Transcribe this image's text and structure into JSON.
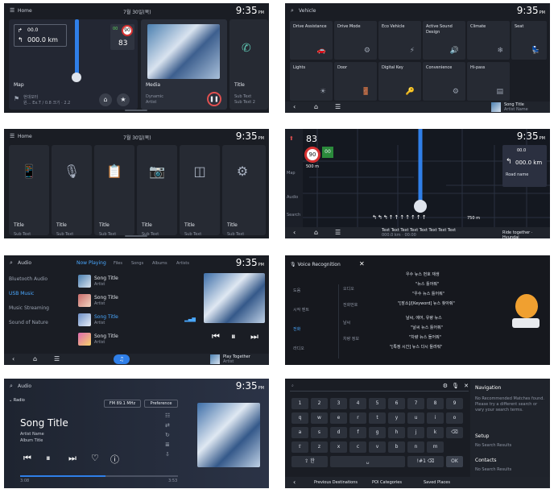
{
  "status": {
    "time": "9:35",
    "ampm": "PM",
    "date": "7월 30일(목)"
  },
  "p1": {
    "title": "Home",
    "dist1": "00.0",
    "dist2": "000.0 km",
    "speed_limit": "90",
    "speed_small": "00",
    "speed": "83",
    "map_label": "Map",
    "map_sub1": "현대모터",
    "map_sub2": "원… Ex.T / 0.8 크기 · 2.2",
    "media_label": "Media",
    "media_sub1": "Dynamic",
    "media_sub2": "Artist",
    "title_label": "Title",
    "sub1": "Sub Text",
    "sub2": "Sub Text 2"
  },
  "p2": {
    "search_text": "Vehicle",
    "tiles": [
      {
        "label": "Drive Assistance",
        "icon": "🚗"
      },
      {
        "label": "Drive Mode",
        "icon": "⚙"
      },
      {
        "label": "Eco Vehicle",
        "icon": "⚡"
      },
      {
        "label": "Active Sound Design",
        "icon": "🔊"
      },
      {
        "label": "Climate",
        "icon": "❄"
      },
      {
        "label": "Seat",
        "icon": "💺"
      },
      {
        "label": "Lights",
        "icon": "☀"
      },
      {
        "label": "Door",
        "icon": "🚪"
      },
      {
        "label": "Digital Key",
        "icon": "🔑"
      },
      {
        "label": "Convenience",
        "icon": "⚙"
      },
      {
        "label": "Hi-pass",
        "icon": "▤"
      }
    ],
    "song": "Song Title",
    "artist": "Artist Name"
  },
  "p3": {
    "title": "Home",
    "tiles": [
      {
        "icon": "📱",
        "title": "Title",
        "s1": "Sub Text",
        "s2": "Sub Text 2"
      },
      {
        "icon": "🎙",
        "title": "Title",
        "s1": "Sub Text",
        "s2": "Sub Text 2"
      },
      {
        "icon": "📋",
        "title": "Title",
        "s1": "Sub Text",
        "s2": "Sub Text 2"
      },
      {
        "icon": "📷",
        "title": "Title",
        "s1": "Sub Text",
        "s2": "Sub Text 2"
      },
      {
        "icon": "◫",
        "title": "Title",
        "s1": "Sub Text",
        "s2": "Sub Text 2"
      },
      {
        "icon": "⚙",
        "title": "Title",
        "s1": "Sub Text",
        "s2": "Sub Text 2"
      }
    ]
  },
  "p4": {
    "speed": "83",
    "limit": "90",
    "green": "00",
    "dist": "500 m",
    "side1": "Map",
    "side2": "Audio",
    "side3": "Search",
    "top_dist": "00.0",
    "main_dist": "000.0 km",
    "road": "Road name",
    "lane_dist": "750 m",
    "bottom_text": "Text Text Text Text Text Text Text Text",
    "bottom_sub": "000.0 km · 00:00",
    "bottom_right": "Ride together · Hyundai"
  },
  "p5": {
    "title": "Audio",
    "tabs": [
      "Now Playing",
      "Files",
      "Songs",
      "Albums",
      "Artists"
    ],
    "sources": [
      "Bluetooth Audio",
      "USB Music",
      "Music Streaming",
      "Sound of Nature"
    ],
    "songs": [
      {
        "title": "Song Title",
        "artist": "Artist"
      },
      {
        "title": "Song Title",
        "artist": "Artist"
      },
      {
        "title": "Song Title",
        "artist": "Artist"
      },
      {
        "title": "Song Title",
        "artist": "Artist"
      }
    ],
    "np_title": "Play Together",
    "np_sub": "Artist"
  },
  "p6": {
    "title": "Voice Recognition",
    "menu": [
      "도움",
      "시작 멘트",
      "전화",
      "라디오"
    ],
    "rows": [
      {
        "cat": "오디오",
        "lines": [
          "우수 뉴스 번호 재생",
          "\"뉴스 틀어줘\"",
          "\"우수 뉴스 틀어줘\""
        ]
      },
      {
        "cat": "전화번호",
        "lines": [
          "\"[장소]/[Keyword] 뉴스 찾아줘\""
        ]
      },
      {
        "cat": "날씨",
        "lines": [
          "날씨, 에어, 유량 뉴스",
          "\"날씨 뉴스 틀어줘\""
        ]
      },
      {
        "cat": "차량 정보",
        "lines": [
          "\"차량 뉴스 들어줘\"",
          "\"[특정 시간] 뉴스 다시 들려줘\""
        ]
      }
    ]
  },
  "p7": {
    "title": "Audio",
    "source": "Radio",
    "band": "FM 89.1 MHz",
    "pref": "Preference",
    "song": "Song Title",
    "artist": "Artist Name",
    "album": "Album Title",
    "time_start": "3:08",
    "time_end": "3:53"
  },
  "p8": {
    "keys_row1": [
      "1",
      "2",
      "3",
      "4",
      "5",
      "6",
      "7",
      "8",
      "9"
    ],
    "keys_row2": [
      "q",
      "w",
      "e",
      "r",
      "t",
      "y",
      "u",
      "i",
      "o",
      "p"
    ],
    "keys_row3": [
      "a",
      "s",
      "d",
      "f",
      "g",
      "h",
      "j",
      "k",
      "l"
    ],
    "keys_row4": [
      "z",
      "x",
      "c",
      "v",
      "b",
      "n",
      "m"
    ],
    "ok": "OK",
    "side_nav": "Navigation",
    "side_nav_text": "No Recommended Matches found. Please try a different search or vary your search terms.",
    "side_setup": "Setup",
    "side_setup_text": "No Search Results",
    "side_contacts": "Contacts",
    "side_contacts_text": "No Search Results",
    "bottom_tabs": [
      "Previous Destinations",
      "POI Categories",
      "Saved Places"
    ]
  }
}
